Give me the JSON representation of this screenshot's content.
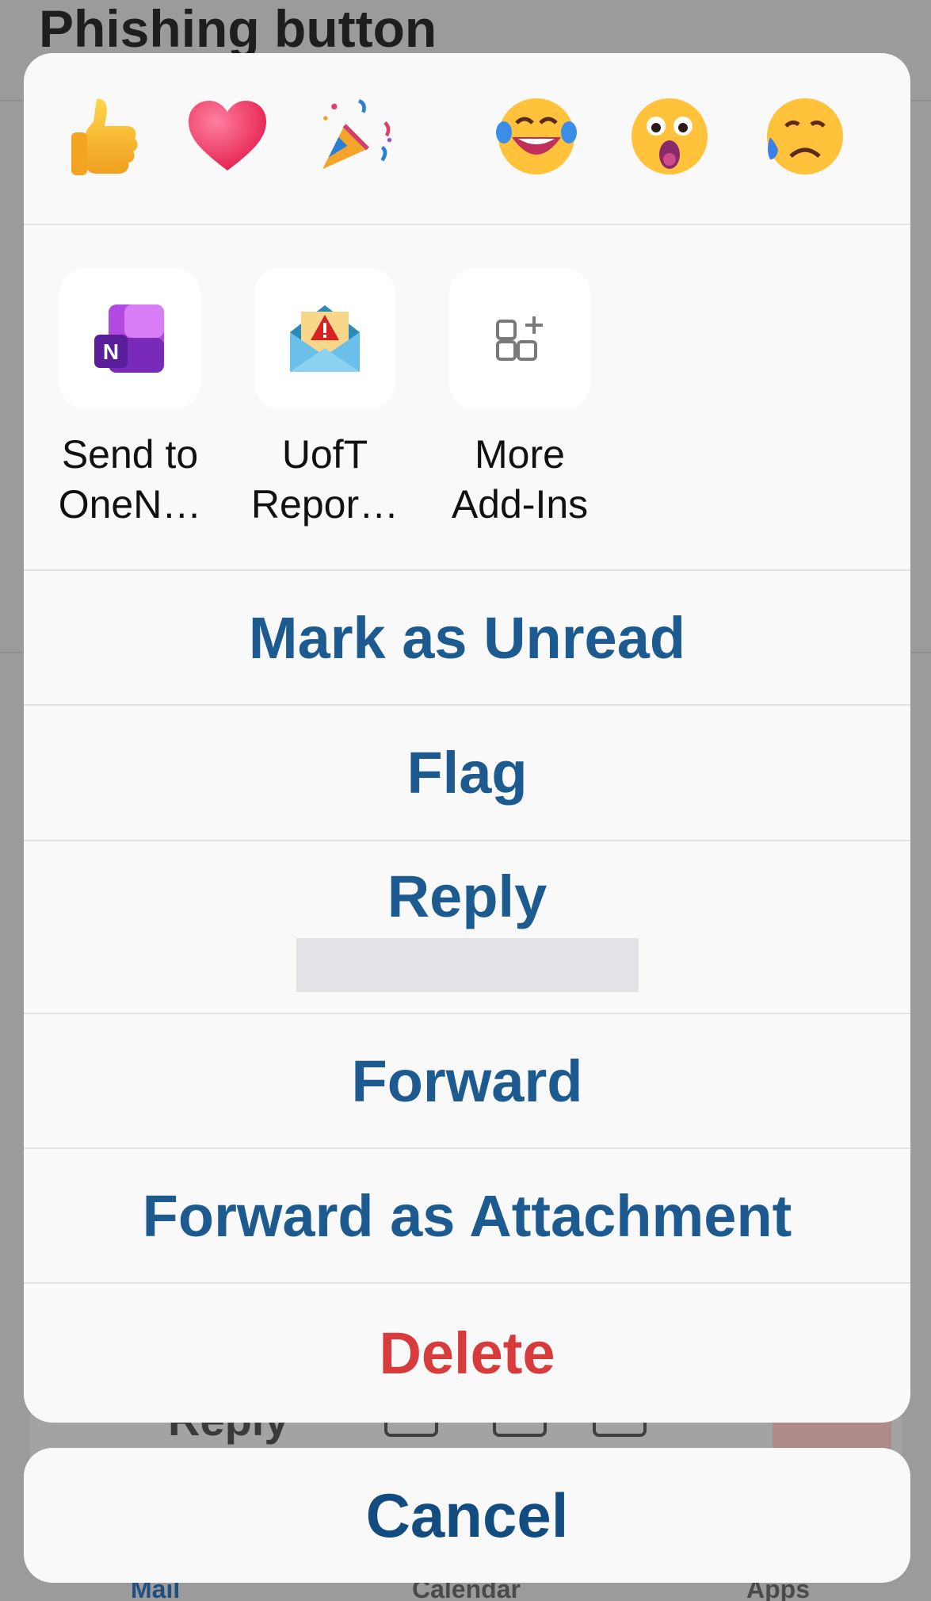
{
  "background": {
    "title": "Phishing button",
    "reply_label": "Reply",
    "tabs": [
      "Mail",
      "Calendar",
      "Apps"
    ]
  },
  "reactions": [
    {
      "icon": "thumbs-up-icon"
    },
    {
      "icon": "heart-icon"
    },
    {
      "icon": "party-popper-icon"
    },
    {
      "icon": "laughing-face-icon"
    },
    {
      "icon": "surprised-face-icon"
    },
    {
      "icon": "sad-face-icon"
    }
  ],
  "addins": [
    {
      "label": "Send to\nOneN…",
      "icon": "onenote-icon"
    },
    {
      "label": "UofT\nRepor…",
      "icon": "report-phishing-icon"
    },
    {
      "label": "More\nAdd-Ins",
      "icon": "add-apps-icon"
    }
  ],
  "actions": {
    "mark_unread": "Mark as Unread",
    "flag": "Flag",
    "reply": "Reply",
    "forward": "Forward",
    "forward_attachment": "Forward as Attachment",
    "delete": "Delete"
  },
  "cancel": "Cancel",
  "colors": {
    "action_blue": "#1c5a8f",
    "delete_red": "#d83b3b",
    "sheet_bg": "#f9f9f9"
  }
}
